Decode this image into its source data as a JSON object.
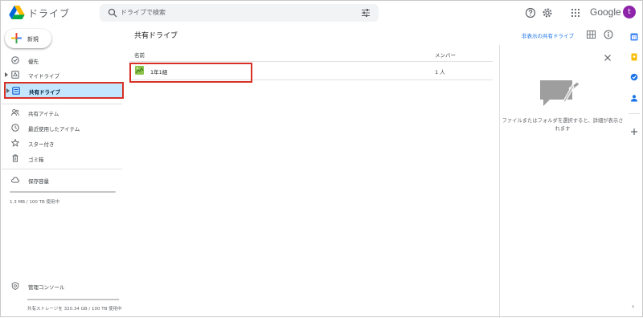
{
  "header": {
    "app_name": "ドライブ",
    "search_placeholder": "ドライブで検索",
    "google_label": "Google",
    "avatar_letter": "t"
  },
  "sidebar": {
    "new_label": "新規",
    "items": [
      {
        "label": "優先"
      },
      {
        "label": "マイドライブ"
      },
      {
        "label": "共有ドライブ"
      },
      {
        "label": "共有アイテム"
      },
      {
        "label": "最近使用したアイテム"
      },
      {
        "label": "スター付き"
      },
      {
        "label": "ゴミ箱"
      },
      {
        "label": "保存容量"
      }
    ],
    "storage_used": "1.3 MB / 100 TB 使用中",
    "storage_fraction": 0.0,
    "admin_console": "管理コンソール",
    "shared_storage": "共有ストレージを 320.34 GB / 100 TB 使用中"
  },
  "main": {
    "title": "共有ドライブ",
    "hidden_link": "非表示の共有ドライブ",
    "columns": {
      "name": "名前",
      "members": "メンバー"
    },
    "rows": [
      {
        "name": "1年1組",
        "members": "1 人"
      }
    ]
  },
  "details": {
    "message": "ファイルまたはフォルダを選択すると、詳細が表示されます"
  },
  "colors": {
    "accent": "#1a73e8",
    "highlight": "#d93025",
    "active_bg": "#c2e7ff"
  }
}
